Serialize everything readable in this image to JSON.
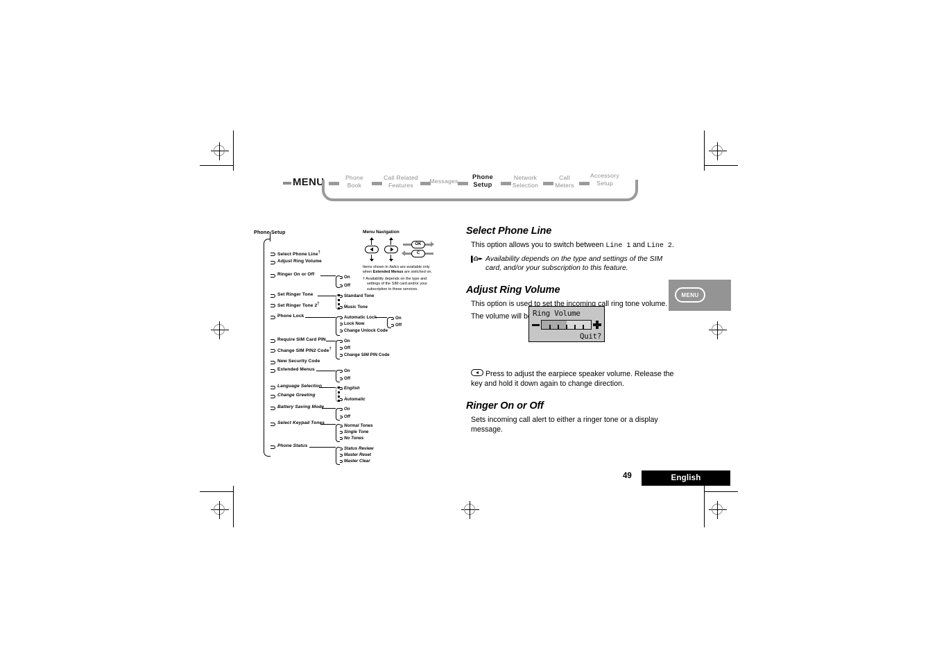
{
  "menu_path": {
    "root_label": "MENU",
    "crumbs": [
      {
        "label": "Phone\nBook",
        "line1": "Phone",
        "line2": "Book",
        "active": false
      },
      {
        "label": "Call Related\nFeatures",
        "line1": "Call Related",
        "line2": "Features",
        "active": false
      },
      {
        "label": "Messages",
        "line1": "Messages",
        "line2": "",
        "active": false
      },
      {
        "label": "Phone\nSetup",
        "line1": "Phone",
        "line2": "Setup",
        "active": true
      },
      {
        "label": "Network\nSelection",
        "line1": "Network",
        "line2": "Selection",
        "active": false
      },
      {
        "label": "Call\nMeters",
        "line1": "Call",
        "line2": "Meters",
        "active": false
      },
      {
        "label": "Accessory\nSetup",
        "line1": "Accessory",
        "line2": "Setup",
        "active": false
      }
    ]
  },
  "tree": {
    "title": "Phone Setup",
    "nodes": [
      {
        "label": "Select Phone Line",
        "dagger": true,
        "italic": false,
        "children": []
      },
      {
        "label": "Adjust Ring Volume",
        "dagger": false,
        "italic": false,
        "children": []
      },
      {
        "label": "Ringer On or Off",
        "dagger": false,
        "italic": false,
        "children": [
          "On",
          "Off"
        ]
      },
      {
        "label": "Set Ringer Tone",
        "dagger": false,
        "italic": false,
        "children": [
          "Standard Tone",
          "Music Tone"
        ]
      },
      {
        "label": "Set Ringer Tone 2",
        "dagger": true,
        "italic": false,
        "children": []
      },
      {
        "label": "Phone Lock",
        "dagger": false,
        "italic": false,
        "children": [
          "Automatic Lock",
          "Lock Now",
          "Change Unlock Code"
        ]
      },
      {
        "label": "Require SIM Card PIN",
        "dagger": false,
        "italic": false,
        "children": [
          "On",
          "Off",
          "Change SIM PIN Code"
        ]
      },
      {
        "label": "Change SIM PIN2 Code",
        "dagger": true,
        "italic": false,
        "children": []
      },
      {
        "label": "New Security Code",
        "dagger": false,
        "italic": false,
        "children": []
      },
      {
        "label": "Extended Menus",
        "dagger": false,
        "italic": false,
        "children": [
          "On",
          "Off"
        ]
      },
      {
        "label": "Language Selection",
        "dagger": false,
        "italic": true,
        "children": [
          "English",
          "Automatic"
        ]
      },
      {
        "label": "Change Greeting",
        "dagger": false,
        "italic": true,
        "children": []
      },
      {
        "label": "Battery Saving Mode",
        "dagger": false,
        "italic": true,
        "children": [
          "On",
          "Off"
        ]
      },
      {
        "label": "Select Keypad Tones",
        "dagger": false,
        "italic": true,
        "children": [
          "Normal Tones",
          "Single Tone",
          "No Tones"
        ]
      },
      {
        "label": "Phone Status",
        "dagger": false,
        "italic": true,
        "children": [
          "Status Review",
          "Master Reset",
          "Master Clear"
        ]
      }
    ],
    "lock_sub": [
      "On",
      "Off"
    ]
  },
  "nav_legend": {
    "title": "Menu Navigation",
    "keys": {
      "ok": "OK",
      "clear": "C"
    },
    "italics_note_part1": "Items shown in ",
    "italics_note_italic": "Italics",
    "italics_note_part2": " are available only when ",
    "italics_note_bold": "Extended Menus",
    "italics_note_part3": " are switched on.",
    "dagger_note": "† Availability depends on the type and settings of the SIM card and/or your subscription to these services."
  },
  "content": {
    "sections": [
      {
        "heading": "Select Phone Line",
        "body_pre": "This option allows you to switch between ",
        "body_mono1": "Line 1",
        "body_mid": " and ",
        "body_mono2": "Line 2",
        "body_post": ".",
        "note": "Availability depends on the type and settings of the SIM card, and/or your subscription to this feature."
      },
      {
        "heading": "Adjust Ring Volume",
        "line1": "This option is used to set the incoming call ring tone volume.",
        "line2": "The volume will be displayed as follows:",
        "key_note": "Press to adjust the earpiece speaker volume. Release the key and hold it down again to change direction."
      },
      {
        "heading": "Ringer On or Off",
        "line1": "Sets incoming call alert to either a ringer tone or a display message."
      }
    ]
  },
  "lcd": {
    "title": "Ring Volume",
    "softkey": "Quit?",
    "volume_level": 3,
    "volume_max": 7
  },
  "side_tab": {
    "label": "MENU",
    "bg": "#949494"
  },
  "footer": {
    "page_number": "49",
    "language": "English",
    "bar_bg": "#000000"
  }
}
